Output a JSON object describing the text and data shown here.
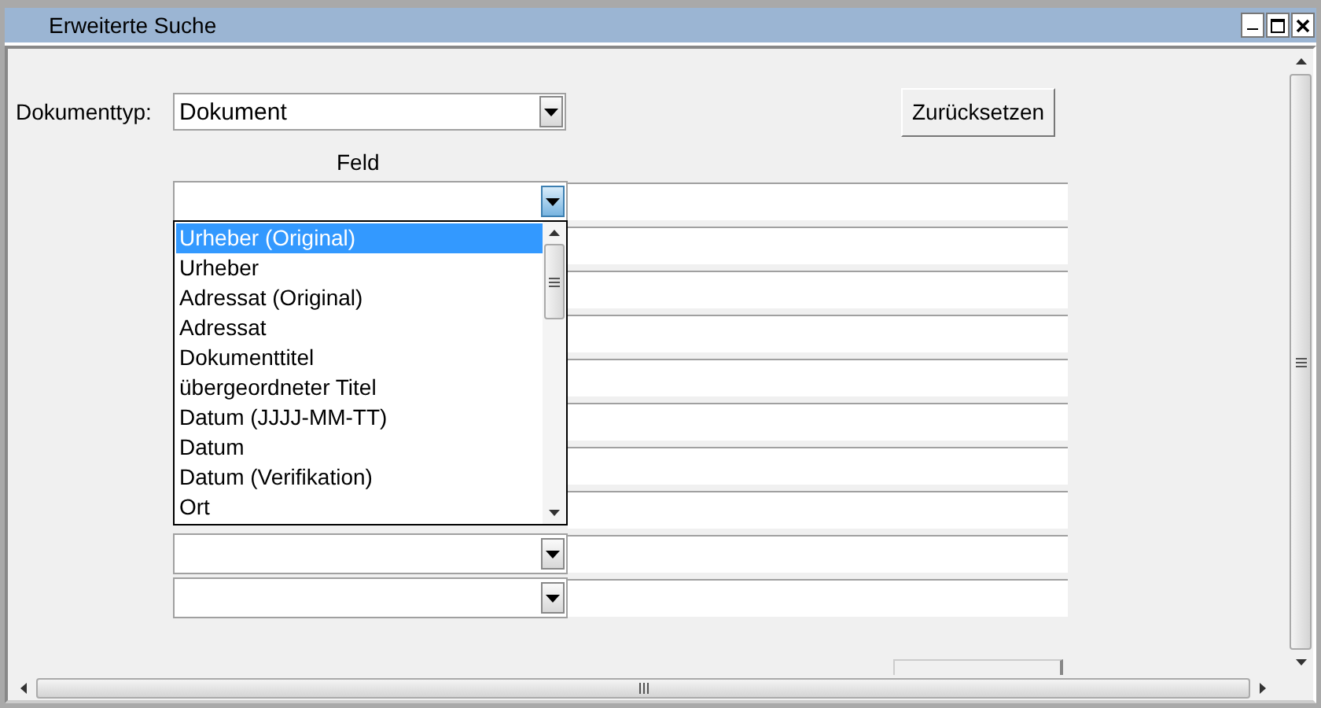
{
  "window": {
    "title": "Erweiterte Suche"
  },
  "document_type": {
    "label": "Dokumenttyp:",
    "value": "Dokument"
  },
  "reset_button": "Zurücksetzen",
  "field_header": "Feld",
  "rows": [
    {
      "kind": "combo"
    },
    {
      "kind": "covered"
    },
    {
      "kind": "covered"
    },
    {
      "kind": "covered"
    },
    {
      "kind": "covered"
    },
    {
      "kind": "covered"
    },
    {
      "kind": "covered"
    },
    {
      "kind": "covered"
    },
    {
      "kind": "combo"
    },
    {
      "kind": "combo"
    }
  ],
  "dropdown": {
    "items": [
      {
        "label": "Urheber (Original)",
        "selected": true
      },
      {
        "label": "Urheber",
        "selected": false
      },
      {
        "label": "Adressat (Original)",
        "selected": false
      },
      {
        "label": "Adressat",
        "selected": false
      },
      {
        "label": "Dokumenttitel",
        "selected": false
      },
      {
        "label": "übergeordneter Titel",
        "selected": false
      },
      {
        "label": "Datum (JJJJ-MM-TT)",
        "selected": false
      },
      {
        "label": "Datum",
        "selected": false
      },
      {
        "label": "Datum (Verifikation)",
        "selected": false
      },
      {
        "label": "Ort",
        "selected": false
      }
    ]
  }
}
